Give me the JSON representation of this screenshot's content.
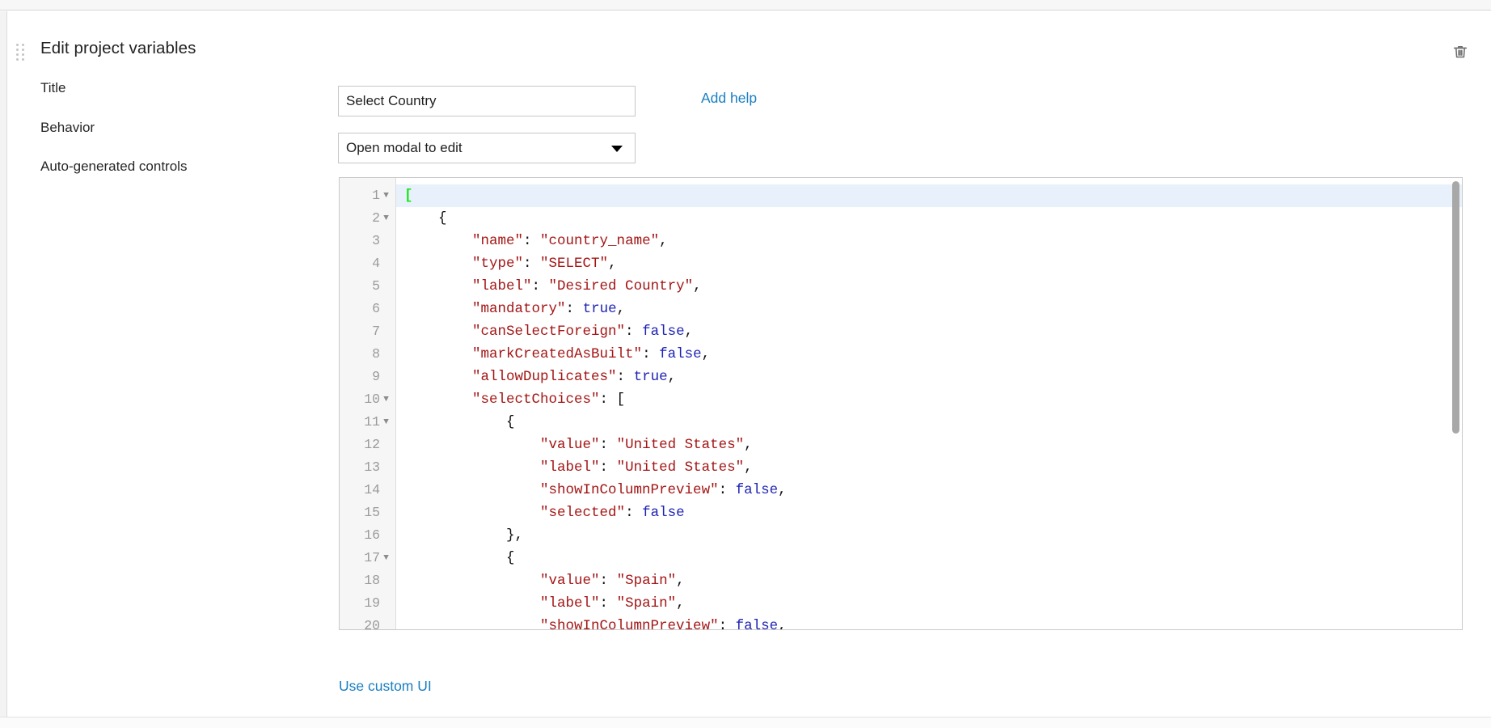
{
  "panel": {
    "title": "Edit project variables",
    "drag_handle_name": "drag-handle",
    "delete_tooltip": "Delete"
  },
  "form": {
    "title_label": "Title",
    "title_value": "Select Country",
    "title_placeholder": "Title",
    "behavior_label": "Behavior",
    "behavior_value": "Open modal to edit",
    "behavior_options": [
      "Open modal to edit"
    ],
    "auto_label": "Auto-generated controls",
    "add_help_link": "Add help",
    "custom_ui_link": "Use custom UI"
  },
  "editor": {
    "active_line": 1,
    "first_visible_line": 1,
    "last_visible_line": 20,
    "lines": [
      {
        "n": 1,
        "fold": true,
        "tokens": [
          {
            "t": "[",
            "c": "gr"
          }
        ]
      },
      {
        "n": 2,
        "fold": true,
        "tokens": [
          {
            "t": "    {",
            "c": "p"
          }
        ]
      },
      {
        "n": 3,
        "fold": false,
        "tokens": [
          {
            "t": "        ",
            "c": "p"
          },
          {
            "t": "\"name\"",
            "c": "k"
          },
          {
            "t": ": ",
            "c": "p"
          },
          {
            "t": "\"country_name\"",
            "c": "k"
          },
          {
            "t": ",",
            "c": "p"
          }
        ]
      },
      {
        "n": 4,
        "fold": false,
        "tokens": [
          {
            "t": "        ",
            "c": "p"
          },
          {
            "t": "\"type\"",
            "c": "k"
          },
          {
            "t": ": ",
            "c": "p"
          },
          {
            "t": "\"SELECT\"",
            "c": "k"
          },
          {
            "t": ",",
            "c": "p"
          }
        ]
      },
      {
        "n": 5,
        "fold": false,
        "tokens": [
          {
            "t": "        ",
            "c": "p"
          },
          {
            "t": "\"label\"",
            "c": "k"
          },
          {
            "t": ": ",
            "c": "p"
          },
          {
            "t": "\"Desired Country\"",
            "c": "k"
          },
          {
            "t": ",",
            "c": "p"
          }
        ]
      },
      {
        "n": 6,
        "fold": false,
        "tokens": [
          {
            "t": "        ",
            "c": "p"
          },
          {
            "t": "\"mandatory\"",
            "c": "k"
          },
          {
            "t": ": ",
            "c": "p"
          },
          {
            "t": "true",
            "c": "b"
          },
          {
            "t": ",",
            "c": "p"
          }
        ]
      },
      {
        "n": 7,
        "fold": false,
        "tokens": [
          {
            "t": "        ",
            "c": "p"
          },
          {
            "t": "\"canSelectForeign\"",
            "c": "k"
          },
          {
            "t": ": ",
            "c": "p"
          },
          {
            "t": "false",
            "c": "b"
          },
          {
            "t": ",",
            "c": "p"
          }
        ]
      },
      {
        "n": 8,
        "fold": false,
        "tokens": [
          {
            "t": "        ",
            "c": "p"
          },
          {
            "t": "\"markCreatedAsBuilt\"",
            "c": "k"
          },
          {
            "t": ": ",
            "c": "p"
          },
          {
            "t": "false",
            "c": "b"
          },
          {
            "t": ",",
            "c": "p"
          }
        ]
      },
      {
        "n": 9,
        "fold": false,
        "tokens": [
          {
            "t": "        ",
            "c": "p"
          },
          {
            "t": "\"allowDuplicates\"",
            "c": "k"
          },
          {
            "t": ": ",
            "c": "p"
          },
          {
            "t": "true",
            "c": "b"
          },
          {
            "t": ",",
            "c": "p"
          }
        ]
      },
      {
        "n": 10,
        "fold": true,
        "tokens": [
          {
            "t": "        ",
            "c": "p"
          },
          {
            "t": "\"selectChoices\"",
            "c": "k"
          },
          {
            "t": ": [",
            "c": "p"
          }
        ]
      },
      {
        "n": 11,
        "fold": true,
        "tokens": [
          {
            "t": "            {",
            "c": "p"
          }
        ]
      },
      {
        "n": 12,
        "fold": false,
        "tokens": [
          {
            "t": "                ",
            "c": "p"
          },
          {
            "t": "\"value\"",
            "c": "k"
          },
          {
            "t": ": ",
            "c": "p"
          },
          {
            "t": "\"United States\"",
            "c": "k"
          },
          {
            "t": ",",
            "c": "p"
          }
        ]
      },
      {
        "n": 13,
        "fold": false,
        "tokens": [
          {
            "t": "                ",
            "c": "p"
          },
          {
            "t": "\"label\"",
            "c": "k"
          },
          {
            "t": ": ",
            "c": "p"
          },
          {
            "t": "\"United States\"",
            "c": "k"
          },
          {
            "t": ",",
            "c": "p"
          }
        ]
      },
      {
        "n": 14,
        "fold": false,
        "tokens": [
          {
            "t": "                ",
            "c": "p"
          },
          {
            "t": "\"showInColumnPreview\"",
            "c": "k"
          },
          {
            "t": ": ",
            "c": "p"
          },
          {
            "t": "false",
            "c": "b"
          },
          {
            "t": ",",
            "c": "p"
          }
        ]
      },
      {
        "n": 15,
        "fold": false,
        "tokens": [
          {
            "t": "                ",
            "c": "p"
          },
          {
            "t": "\"selected\"",
            "c": "k"
          },
          {
            "t": ": ",
            "c": "p"
          },
          {
            "t": "false",
            "c": "b"
          }
        ]
      },
      {
        "n": 16,
        "fold": false,
        "tokens": [
          {
            "t": "            },",
            "c": "p"
          }
        ]
      },
      {
        "n": 17,
        "fold": true,
        "tokens": [
          {
            "t": "            {",
            "c": "p"
          }
        ]
      },
      {
        "n": 18,
        "fold": false,
        "tokens": [
          {
            "t": "                ",
            "c": "p"
          },
          {
            "t": "\"value\"",
            "c": "k"
          },
          {
            "t": ": ",
            "c": "p"
          },
          {
            "t": "\"Spain\"",
            "c": "k"
          },
          {
            "t": ",",
            "c": "p"
          }
        ]
      },
      {
        "n": 19,
        "fold": false,
        "tokens": [
          {
            "t": "                ",
            "c": "p"
          },
          {
            "t": "\"label\"",
            "c": "k"
          },
          {
            "t": ": ",
            "c": "p"
          },
          {
            "t": "\"Spain\"",
            "c": "k"
          },
          {
            "t": ",",
            "c": "p"
          }
        ]
      },
      {
        "n": 20,
        "fold": false,
        "tokens": [
          {
            "t": "                ",
            "c": "p"
          },
          {
            "t": "\"showInColumnPreview\"",
            "c": "k"
          },
          {
            "t": ": ",
            "c": "p"
          },
          {
            "t": "false",
            "c": "b"
          },
          {
            "t": ",",
            "c": "p"
          }
        ]
      }
    ]
  },
  "colors": {
    "link": "#1a7fc1",
    "string": "#a31515",
    "boolean": "#1d23b4",
    "matched_bracket": "#17e617",
    "active_line": "#e8f1fb",
    "input_border": "#c6c6c6"
  }
}
